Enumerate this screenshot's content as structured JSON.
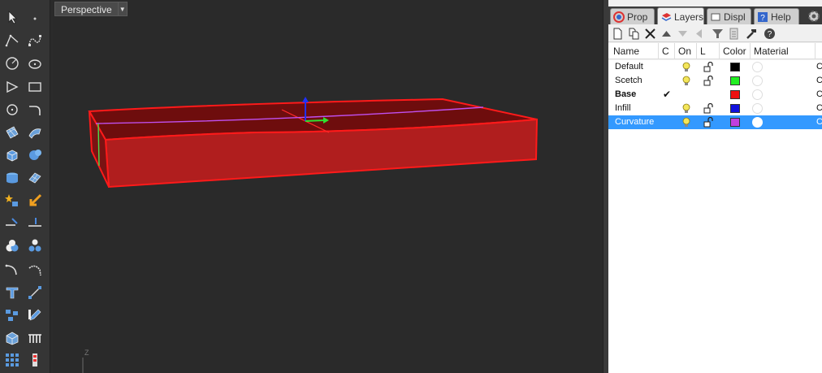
{
  "viewport": {
    "title": "Perspective",
    "axis_label": "Z"
  },
  "panel": {
    "tabs": [
      {
        "label": "Prop",
        "icon": "properties-icon",
        "active": false
      },
      {
        "label": "Layers",
        "icon": "layers-icon",
        "active": true
      },
      {
        "label": "Displ",
        "icon": "display-icon",
        "active": false
      },
      {
        "label": "Help",
        "icon": "help-icon",
        "active": false
      }
    ],
    "columns": {
      "name": "Name",
      "current": "C",
      "on": "On",
      "lock": "L",
      "color": "Color",
      "material": "Material"
    },
    "layers": [
      {
        "name": "Default",
        "current": "",
        "on": true,
        "locked": false,
        "color": "#000000",
        "selected": false,
        "bold": false
      },
      {
        "name": "Scetch",
        "current": "",
        "on": true,
        "locked": false,
        "color": "#22ee22",
        "selected": false,
        "bold": false
      },
      {
        "name": "Base",
        "current": "✔",
        "on": false,
        "locked": false,
        "color": "#ee1111",
        "selected": false,
        "bold": true
      },
      {
        "name": "Infill",
        "current": "",
        "on": true,
        "locked": false,
        "color": "#1111dd",
        "selected": false,
        "bold": false
      },
      {
        "name": "Curvature",
        "current": "",
        "on": true,
        "locked": false,
        "color": "#c040e0",
        "selected": true,
        "bold": false
      }
    ],
    "edge_glyph": "C"
  }
}
